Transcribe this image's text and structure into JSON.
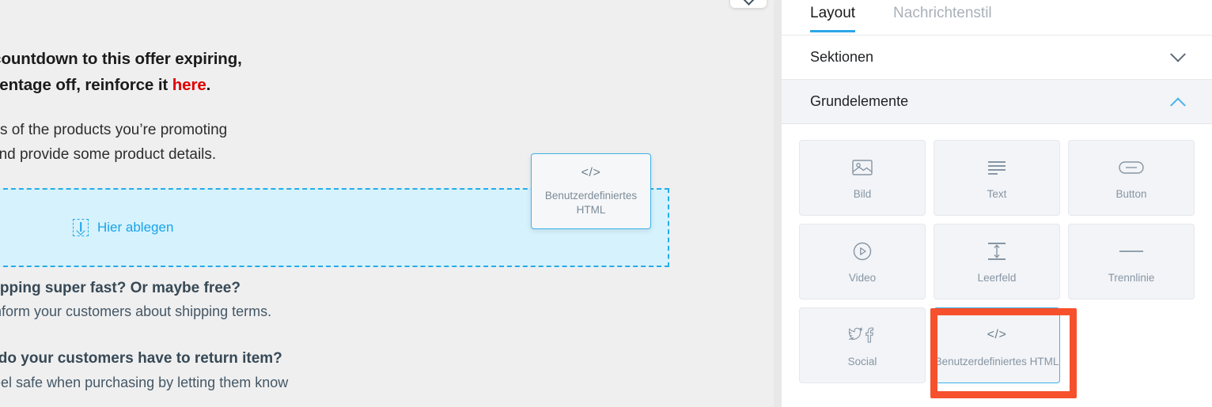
{
  "canvas": {
    "email": {
      "heading_lines": [
        {
          "text": "re is a countdown to this offer expiring,",
          "accent": "",
          "accent_tail": ""
        },
        {
          "text": "r a percentage off, reinforce it ",
          "accent": "here",
          "accent_tail": "."
        }
      ],
      "body_lines": [
        "de photos of the products you’re promoting",
        "and provide some product details."
      ],
      "section_shipping": {
        "heading": "your shipping super fast? Or maybe free?",
        "body": "ctice to inform your customers about shipping terms."
      },
      "section_returns": {
        "heading": "ch time do your customers have to return item?",
        "body": "tomers feel safe when purchasing by letting them know"
      }
    },
    "dropzone": {
      "label": "Hier ablegen",
      "icon": "drop-arrow-icon",
      "fill_color": "#d6f2fd",
      "border_color": "#27abe8"
    },
    "drag_ghost": {
      "icon": "code-icon",
      "glyph": "</>",
      "label": "Benutzerdefiniertes HTML",
      "border_color": "#3cb3e8"
    },
    "collapse_button": {
      "icon": "chevron-down-icon"
    }
  },
  "panel": {
    "tabs": [
      {
        "label": "Layout",
        "active": true
      },
      {
        "label": "Nachrichtenstil",
        "active": false
      }
    ],
    "accent_color": "#2aa7e8",
    "accordions": [
      {
        "label": "Sektionen",
        "expanded": false,
        "icon": "chevron-down-icon"
      },
      {
        "label": "Grundelemente",
        "expanded": true,
        "icon": "chevron-up-icon"
      }
    ],
    "elements": [
      {
        "label": "Bild",
        "icon": "image-icon",
        "selected": false
      },
      {
        "label": "Text",
        "icon": "text-lines-icon",
        "selected": false
      },
      {
        "label": "Button",
        "icon": "button-pill-icon",
        "selected": false
      },
      {
        "label": "Video",
        "icon": "play-circle-icon",
        "selected": false
      },
      {
        "label": "Leerfeld",
        "icon": "spacer-icon",
        "selected": false
      },
      {
        "label": "Trennlinie",
        "icon": "divider-line-icon",
        "selected": false
      },
      {
        "label": "Social",
        "icon": "social-icon",
        "selected": false
      },
      {
        "label": "Benutzerdefiniertes HTML",
        "icon": "code-icon",
        "glyph": "</>",
        "selected": true
      }
    ],
    "annotation": {
      "color": "#f6512c",
      "target": "Benutzerdefiniertes HTML"
    }
  }
}
